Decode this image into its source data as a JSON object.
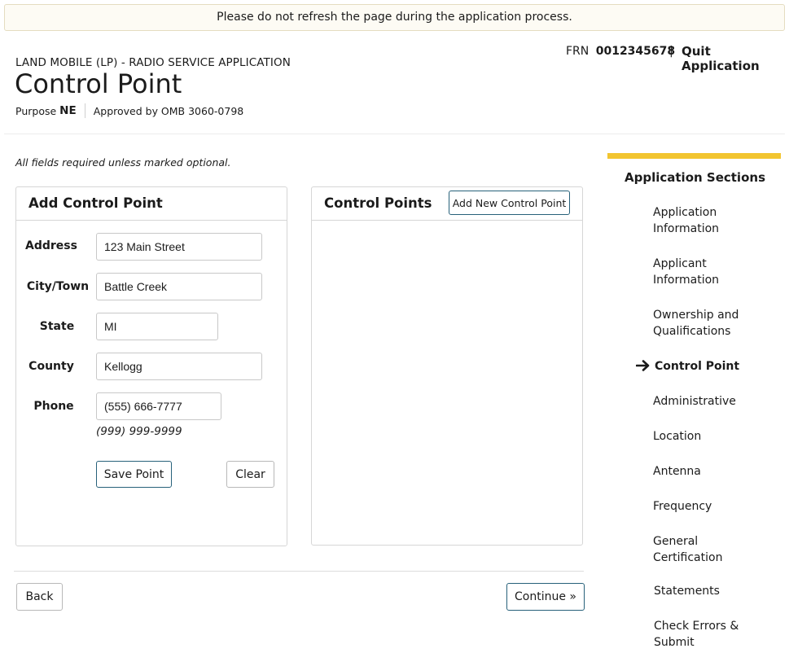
{
  "banner": {
    "text": "Please do not refresh the page during the application process."
  },
  "header": {
    "frn_label": "FRN",
    "frn_value": "0012345678",
    "separator": "|",
    "quit_label": "Quit Application",
    "service": "LAND MOBILE (LP) - RADIO SERVICE APPLICATION",
    "title": "Control Point",
    "purpose_label": "Purpose",
    "purpose_value": "NE",
    "omb": "Approved by OMB 3060-0798"
  },
  "form_note": "All fields required unless marked optional.",
  "add_panel": {
    "title": "Add Control Point",
    "address_label": "Address",
    "address_value": "123 Main Street",
    "city_label": "City/Town",
    "city_value": "Battle Creek",
    "state_label": "State",
    "state_value": "MI",
    "county_label": "County",
    "county_value": "Kellogg",
    "phone_label": "Phone",
    "phone_value": "(555) 666-7777",
    "phone_hint": "(999) 999-9999",
    "save_label": "Save Point",
    "clear_label": "Clear"
  },
  "list_panel": {
    "title": "Control Points",
    "add_new_label": "Add New Control Point"
  },
  "footer": {
    "back_label": "Back",
    "continue_label": "Continue »"
  },
  "sidebar": {
    "title": "Application Sections",
    "accent_color": "#f2c530",
    "items": [
      {
        "label": "Application Information"
      },
      {
        "label": "Applicant Information"
      },
      {
        "label": "Ownership and Qualifications"
      },
      {
        "label": "Control Point",
        "current": true
      },
      {
        "label": "Administrative"
      },
      {
        "label": "Location"
      },
      {
        "label": "Antenna"
      },
      {
        "label": "Frequency"
      },
      {
        "label": "General Certification"
      },
      {
        "label": "Statements"
      },
      {
        "label": "Check Errors & Submit"
      }
    ]
  }
}
